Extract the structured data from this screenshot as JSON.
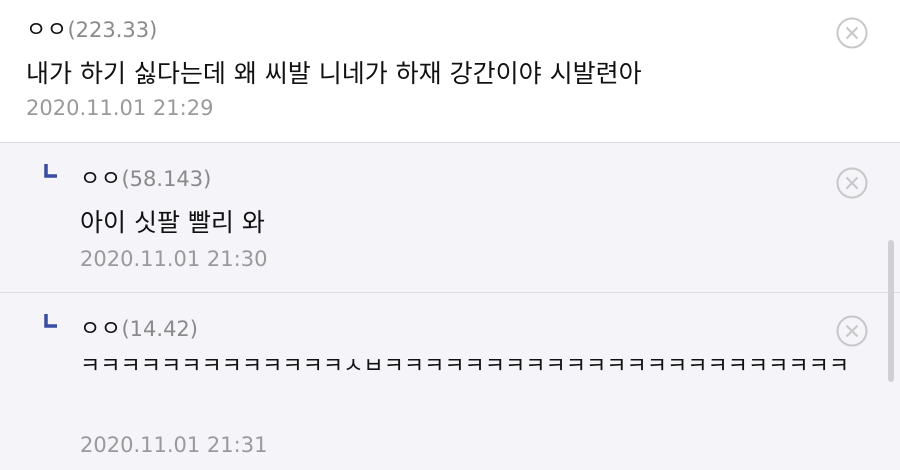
{
  "comments": [
    {
      "nickname": "ㅇㅇ",
      "ip": "(223.33)",
      "text": "내가 하기 싫다는데 왜 씨발 니네가 하재 강간이야 시발련아",
      "date": "2020.11.01 21:29"
    },
    {
      "nickname": "ㅇㅇ",
      "ip": "(58.143)",
      "text": "아이 싯팔 빨리 와",
      "date": "2020.11.01 21:30"
    },
    {
      "nickname": "ㅇㅇ",
      "ip": "(14.42)",
      "text": "ㅋㅋㅋㅋㅋㅋㅋㅋㅋㅋㅋㅋㅋㅅㅂㅋㅋㅋㅋㅋㅋㅋㅋㅋㅋㅋㅋㅋㅋㅋㅋㅋㅋㅋㅋㅋㅋㅋ",
      "date": "2020.11.01 21:31"
    }
  ],
  "icons": {
    "delete": "circle-x-icon",
    "reply": "reply-corner-icon"
  },
  "colors": {
    "reply_mark": "#3b4da0",
    "reply_bg": "#f4f4f9",
    "meta_gray": "#9a9a9a"
  }
}
